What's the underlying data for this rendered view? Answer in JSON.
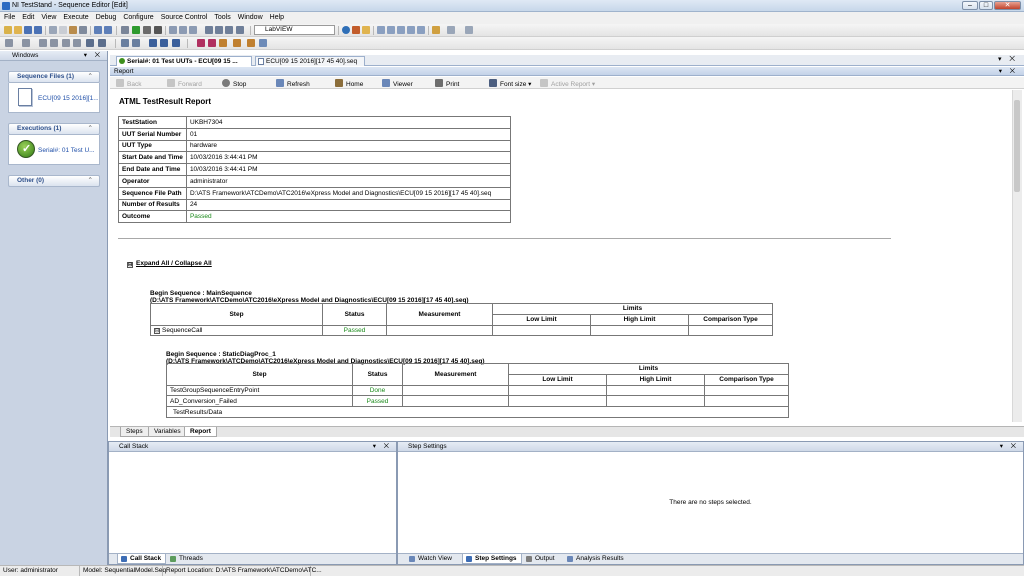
{
  "window": {
    "title": "NI TestStand - Sequence Editor [Edit]"
  },
  "menu": [
    "File",
    "Edit",
    "View",
    "Execute",
    "Debug",
    "Configure",
    "Source Control",
    "Tools",
    "Window",
    "Help"
  ],
  "toolbar": {
    "adapter_select": "LabVIEW"
  },
  "left_pane": {
    "title": "Windows",
    "groups": [
      {
        "header": "Sequence Files (1)",
        "item": "ECU[09 15 2016][1..."
      },
      {
        "header": "Executions (1)",
        "item": "Serial#: 01  Test U..."
      },
      {
        "header": "Other (0)"
      }
    ]
  },
  "doc_tabs": [
    "Serial#: 01  Test UUTs - ECU[09 15 ...",
    "ECU[09 15 2016][17 45 40].seq"
  ],
  "report": {
    "header": "Report",
    "toolbar": {
      "back": "Back",
      "forward": "Forward",
      "stop": "Stop",
      "refresh": "Refresh",
      "home": "Home",
      "viewer": "Viewer",
      "print": "Print",
      "font_size": "Font size",
      "active_report": "Active Report"
    },
    "title": "ATML TestResult Report",
    "info_rows": [
      {
        "k": "TestStation",
        "v": "UKBH7304"
      },
      {
        "k": "UUT Serial Number",
        "v": "01"
      },
      {
        "k": "UUT Type",
        "v": "hardware"
      },
      {
        "k": "Start Date and Time",
        "v": "10/03/2016 3:44:41 PM"
      },
      {
        "k": "End Date and Time",
        "v": "10/03/2016 3:44:41 PM"
      },
      {
        "k": "Operator",
        "v": "administrator"
      },
      {
        "k": "Sequence File Path",
        "v": "D:\\ATS Framework\\ATCDemo\\ATC2016\\eXpress Model and Diagnostics\\ECU[09 15 2016][17 45 40].seq"
      },
      {
        "k": "Number of Results",
        "v": "24"
      },
      {
        "k": "Outcome",
        "v": "Passed"
      }
    ],
    "expand_all": "Expand All / Collapse All",
    "seq1": {
      "line1": "Begin Sequence : MainSequence",
      "line2": "(D:\\ATS Framework\\ATCDemo\\ATC2016\\eXpress Model and Diagnostics\\ECU[09 15 2016][17 45 40].seq)",
      "headers": {
        "step": "Step",
        "status": "Status",
        "measurement": "Measurement",
        "limits": "Limits",
        "low": "Low Limit",
        "high": "High Limit",
        "comp": "Comparison Type"
      },
      "rows": [
        {
          "step": "SequenceCall",
          "status": "Passed"
        }
      ]
    },
    "seq2": {
      "line1": "Begin Sequence : StaticDiagProc_1",
      "line2": "(D:\\ATS Framework\\ATCDemo\\ATC2016\\eXpress Model and Diagnostics\\ECU[09 15 2016][17 45 40].seq)",
      "rows": [
        {
          "step": "TestGroupSequenceEntryPoint",
          "status": "Done"
        },
        {
          "step": "AD_Conversion_Failed",
          "status": "Passed"
        },
        {
          "step": "TestResults/Data",
          "status": ""
        }
      ]
    }
  },
  "bottom_tabs": [
    "Steps",
    "Variables",
    "Report"
  ],
  "callstack": {
    "title": "Call Stack",
    "tabs": [
      "Call Stack",
      "Threads"
    ]
  },
  "stepsettings": {
    "title": "Step Settings",
    "message": "There are no steps selected.",
    "tabs": [
      "Watch View",
      "Step Settings",
      "Output",
      "Analysis Results"
    ]
  },
  "status": {
    "user": "User: administrator",
    "model": "Model: SequentialModel.Seq",
    "location": "Report Location: D:\\ATS Framework\\ATCDemo\\ATC..."
  }
}
